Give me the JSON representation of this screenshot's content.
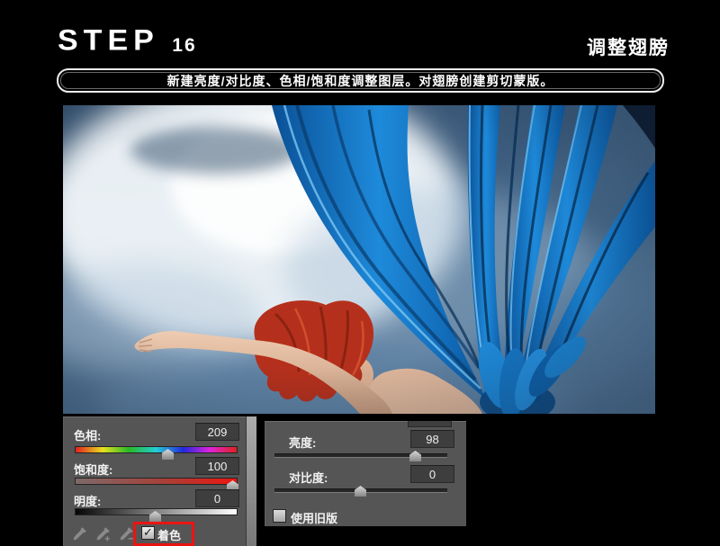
{
  "header": {
    "step_word": "STEP",
    "step_number": "16",
    "page_title": "调整翅膀"
  },
  "instruction": {
    "text": "新建亮度/对比度、色相/饱和度调整图层。对翅膀创建剪切蒙版。"
  },
  "hue_saturation_panel": {
    "hue": {
      "label": "色相:",
      "value": "209"
    },
    "saturation": {
      "label": "饱和度:",
      "value": "100"
    },
    "lightness": {
      "label": "明度:",
      "value": "0"
    },
    "colorize": {
      "label": "着色",
      "checked": true,
      "checkmark": "✓"
    },
    "eyedroppers": [
      "eyedropper",
      "eyedropper-add",
      "eyedropper-subtract"
    ]
  },
  "brightness_contrast_panel": {
    "brightness": {
      "label": "亮度:",
      "value": "98"
    },
    "contrast": {
      "label": "对比度:",
      "value": "0"
    },
    "use_legacy": {
      "label": "使用旧版",
      "checked": false
    }
  },
  "colors": {
    "highlight_red": "#ea1412",
    "panel_gray": "#555555",
    "wing_blue": "#1e8ada",
    "text_white": "#ffffff"
  }
}
